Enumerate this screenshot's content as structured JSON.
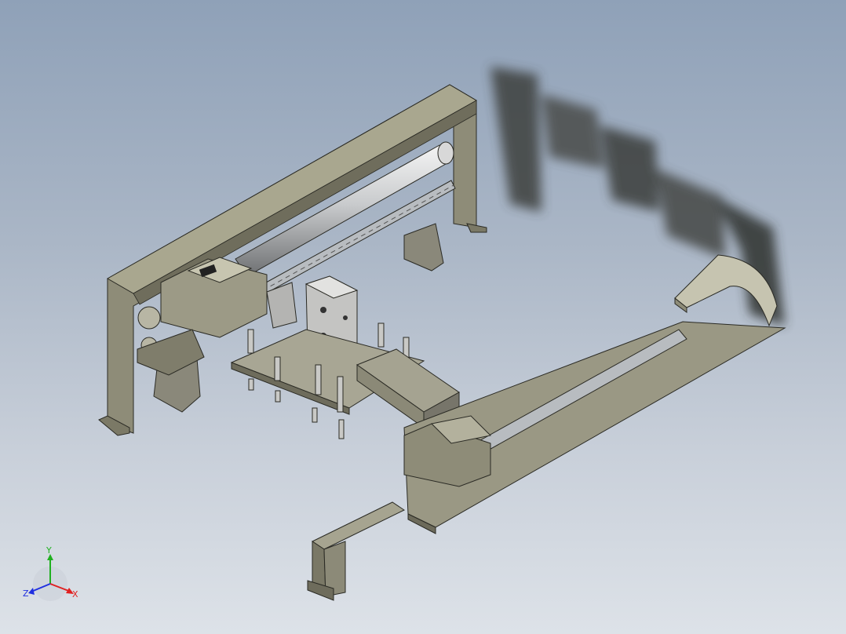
{
  "viewport": {
    "background_top": "#8fa1b8",
    "background_bottom": "#dde2e8"
  },
  "model": {
    "primary_color": "#8e8c78",
    "dark_color": "#4a4a40",
    "rail_color": "#b8bcc0"
  },
  "triad": {
    "x_label": "X",
    "y_label": "Y",
    "z_label": "Z",
    "x_color": "#e02020",
    "y_color": "#20b020",
    "z_color": "#2030e0"
  }
}
